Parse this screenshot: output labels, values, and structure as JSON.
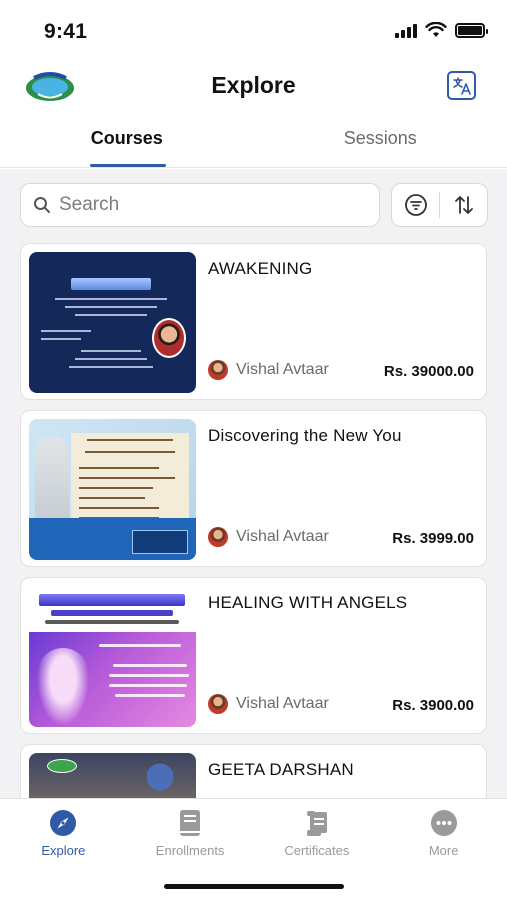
{
  "status_bar": {
    "time": "9:41",
    "battery_level": 1.0
  },
  "header": {
    "title": "Explore",
    "logo_icon": "organization-logo-icon",
    "translate_icon": "translate-icon"
  },
  "tabs": [
    {
      "label": "Courses",
      "active": true
    },
    {
      "label": "Sessions",
      "active": false
    }
  ],
  "search": {
    "placeholder": "Search",
    "value": ""
  },
  "tools": {
    "filter_icon": "filter-icon",
    "sort_icon": "sort-icon"
  },
  "courses": [
    {
      "title": "AWAKENING",
      "instructor": "Vishal Avtaar",
      "price": "Rs. 39000.00"
    },
    {
      "title": "Discovering the New You",
      "instructor": "Vishal Avtaar",
      "price": "Rs. 3999.00"
    },
    {
      "title": "HEALING WITH ANGELS",
      "instructor": "Vishal Avtaar",
      "price": "Rs. 3900.00"
    },
    {
      "title": "GEETA DARSHAN",
      "instructor": "",
      "price": ""
    }
  ],
  "bottom_nav": [
    {
      "label": "Explore",
      "icon": "compass-icon",
      "active": true
    },
    {
      "label": "Enrollments",
      "icon": "book-icon",
      "active": false
    },
    {
      "label": "Certificates",
      "icon": "scroll-icon",
      "active": false
    },
    {
      "label": "More",
      "icon": "more-dots-icon",
      "active": false
    }
  ],
  "colors": {
    "accent": "#2f5aa8",
    "background": "#f2f2f4",
    "inactive": "#9a9a9a"
  }
}
